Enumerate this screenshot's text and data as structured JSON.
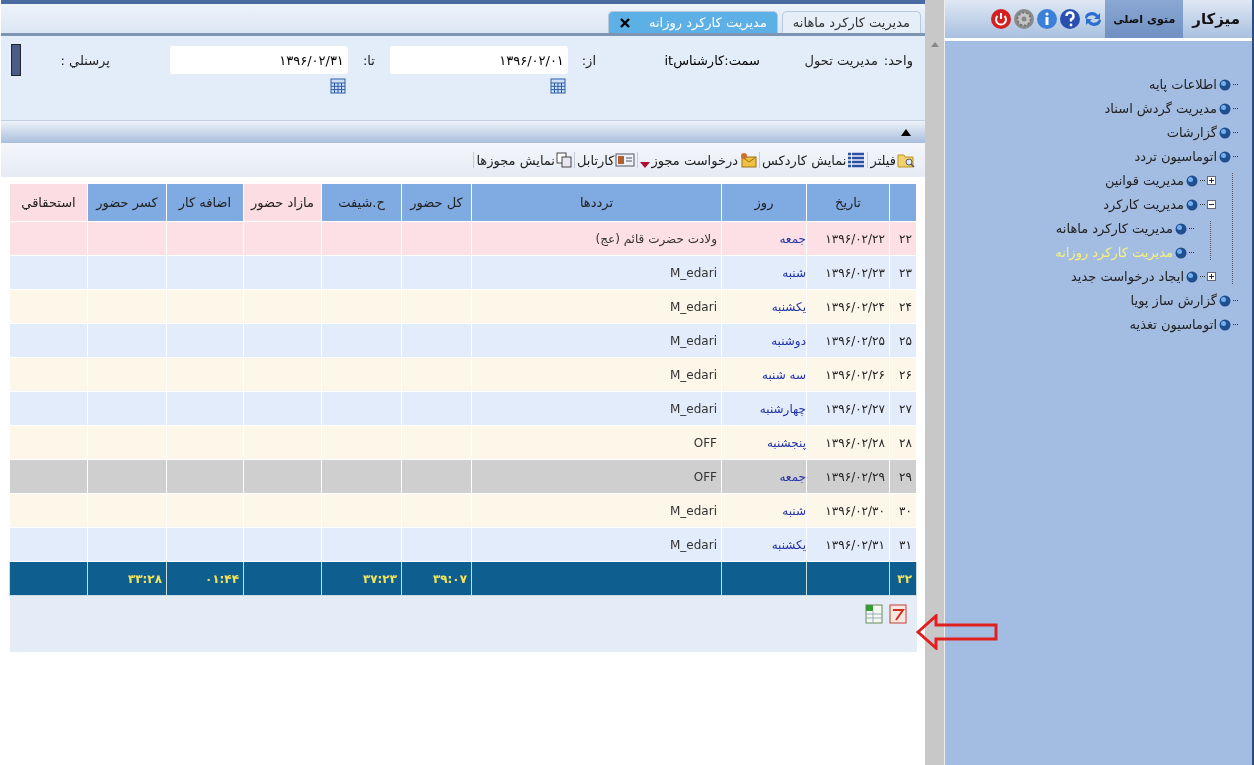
{
  "sidebar": {
    "tabs": [
      {
        "label": "میزکار",
        "selected": false
      },
      {
        "label": "متوی اصلی",
        "selected": true
      }
    ],
    "tree": [
      {
        "label": "اطلاعات پایه",
        "selected": false
      },
      {
        "label": "مدیریت گردش اسناد",
        "selected": false
      },
      {
        "label": "گزارشات",
        "selected": false
      },
      {
        "label": "اتوماسیون تردد",
        "selected": false,
        "children": [
          {
            "label": "مدیریت قوانین",
            "selected": false,
            "expanded": false
          },
          {
            "label": "مدیریت کارکرد",
            "selected": false,
            "expanded": true,
            "children": [
              {
                "label": "مدیریت کارکرد ماهانه",
                "selected": false
              },
              {
                "label": "مدیریت کارکرد روزانه",
                "selected": true
              }
            ]
          },
          {
            "label": "ایجاد درخواست جدید",
            "selected": false,
            "expanded": false
          }
        ]
      },
      {
        "label": "گزارش ساز پویا",
        "selected": false
      },
      {
        "label": "اتوماسیون تغذیه",
        "selected": false
      }
    ]
  },
  "tabs": [
    {
      "label": "مدیریت کارکرد ماهانه",
      "selected": false
    },
    {
      "label": "مدیریت کارکرد روزانه",
      "selected": true
    }
  ],
  "form": {
    "unit_label": "واحد:",
    "unit_value": "مدیریت تحول",
    "position": "سمت:کارشناسit",
    "from_label": "از:",
    "from_value": "۱۳۹۶/۰۲/۰۱",
    "to_label": "تا:",
    "to_value": "۱۳۹۶/۰۲/۳۱",
    "personnel_label": "پرسنلي :"
  },
  "toolbar": [
    {
      "label": "فیلتر",
      "kind": "filter"
    },
    {
      "label": "نمایش کاردکس",
      "kind": "list"
    },
    {
      "label": "درخواست مجوز",
      "kind": "request",
      "dropdown": true
    },
    {
      "label": "کارتابل",
      "kind": "card"
    },
    {
      "label": "نمایش مجوزها",
      "kind": "copy"
    }
  ],
  "table": {
    "columns": [
      {
        "color": "#7faae2"
      },
      {
        "label": "تاریخ",
        "color": "#7faae2"
      },
      {
        "label": "روز",
        "color": "#7faae2"
      },
      {
        "label": "ترددها",
        "color": "#7faae2"
      },
      {
        "label": "کل حضور",
        "color": "#7faae2"
      },
      {
        "label": "ح.شیفت",
        "color": "#7faae2"
      },
      {
        "label": "مازاد حضور",
        "color": "#fcdde4"
      },
      {
        "label": "اضافه کار",
        "color": "#7faae2"
      },
      {
        "label": "کسر حضور",
        "color": "#7faae2"
      },
      {
        "label": "استحقاقي",
        "color": "#fcdde4"
      }
    ],
    "rows": [
      {
        "kind": "holiday",
        "num": "۲۲",
        "date": "۱۳۹۶/۰۲/۲۲",
        "day": "جمعه",
        "log": "ولادت حضرت قائم (عج)"
      },
      {
        "kind": "workday",
        "num": "۲۳",
        "date": "۱۳۹۶/۰۲/۲۳",
        "day": "شنبه",
        "log": "M_edari"
      },
      {
        "kind": "workday",
        "num": "۲۴",
        "date": "۱۳۹۶/۰۲/۲۴",
        "day": "یکشنبه",
        "log": "M_edari"
      },
      {
        "kind": "workday",
        "num": "۲۵",
        "date": "۱۳۹۶/۰۲/۲۵",
        "day": "دوشنبه",
        "log": "M_edari"
      },
      {
        "kind": "workday",
        "num": "۲۶",
        "date": "۱۳۹۶/۰۲/۲۶",
        "day": "سه شنبه",
        "log": "M_edari"
      },
      {
        "kind": "workday",
        "num": "۲۷",
        "date": "۱۳۹۶/۰۲/۲۷",
        "day": "چهارشنبه",
        "log": "M_edari"
      },
      {
        "kind": "workday",
        "num": "۲۸",
        "date": "۱۳۹۶/۰۲/۲۸",
        "day": "پنجشنبه",
        "log": "OFF"
      },
      {
        "kind": "offday",
        "num": "۲۹",
        "date": "۱۳۹۶/۰۲/۲۹",
        "day": "جمعه",
        "log": "OFF"
      },
      {
        "kind": "workday",
        "num": "۳۰",
        "date": "۱۳۹۶/۰۲/۳۰",
        "day": "شنبه",
        "log": "M_edari"
      },
      {
        "kind": "workday",
        "num": "۳۱",
        "date": "۱۳۹۶/۰۲/۳۱",
        "day": "یکشنبه",
        "log": "M_edari"
      }
    ],
    "footer": {
      "count": "۳۲",
      "total_presence": "۳۹:۰۷",
      "shift_hours": "۳۷:۲۳",
      "overtime": "۰۱:۴۴",
      "deficit": "۳۳:۲۸"
    }
  }
}
